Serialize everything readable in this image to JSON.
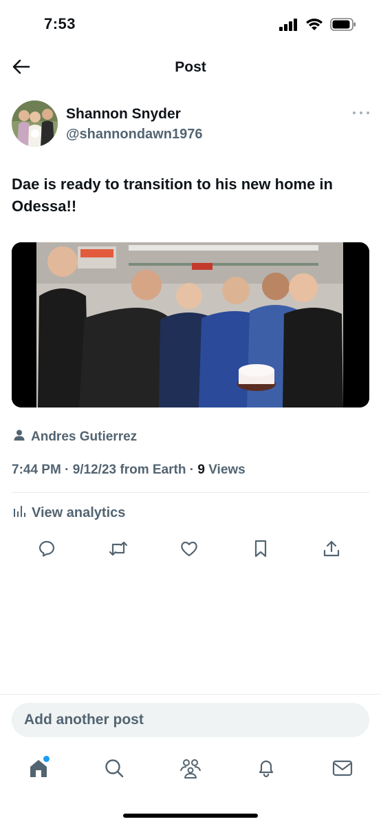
{
  "status_bar": {
    "time": "7:53",
    "icons": [
      "cellular-signal-icon",
      "wifi-icon",
      "battery-icon"
    ]
  },
  "header": {
    "title": "Post",
    "back_icon": "arrow-left-icon"
  },
  "post": {
    "author_name": "Shannon Snyder",
    "author_handle": "@shannondawn1976",
    "text": "Dae is ready to transition to his new home in Odessa!!",
    "media_description": "group photo",
    "tagged_user": "Andres Gutierrez",
    "time": "7:44 PM",
    "date": "9/12/23",
    "source": "from Earth",
    "views_count": "9",
    "views_label": "Views",
    "separator": "·",
    "analytics_label": "View analytics"
  },
  "actions": [
    {
      "name": "reply-icon"
    },
    {
      "name": "repost-icon"
    },
    {
      "name": "like-icon"
    },
    {
      "name": "bookmark-icon"
    },
    {
      "name": "share-icon"
    }
  ],
  "compose": {
    "placeholder": "Add another post"
  },
  "tab_bar": {
    "items": [
      "home-icon",
      "search-icon",
      "communities-icon",
      "notifications-icon",
      "messages-icon"
    ]
  },
  "colors": {
    "text_primary": "#0f1419",
    "text_secondary": "#536471",
    "accent": "#1d9bf0",
    "compose_bg": "#eff3f4",
    "divider": "#e6ecf0"
  }
}
